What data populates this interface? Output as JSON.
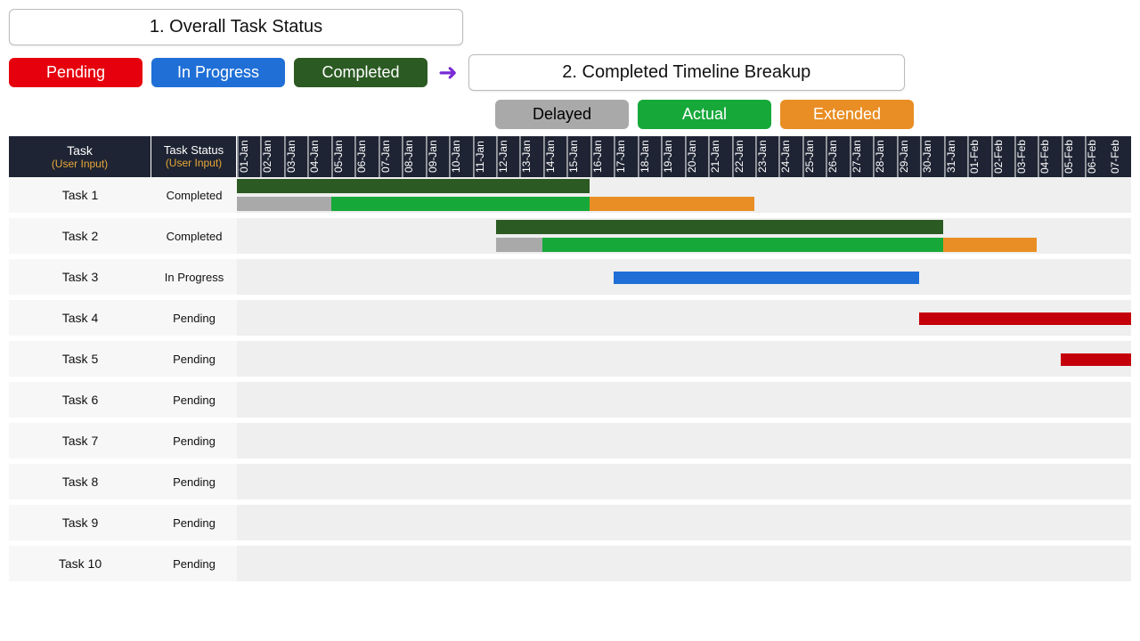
{
  "titles": {
    "overall": "1. Overall Task Status",
    "breakup": "2. Completed Timeline Breakup"
  },
  "legend": {
    "pending": "Pending",
    "in_progress": "In Progress",
    "completed": "Completed",
    "delayed": "Delayed",
    "actual": "Actual",
    "extended": "Extended"
  },
  "columns": {
    "task": "Task",
    "task_sub": "(User Input)",
    "status": "Task Status",
    "status_sub": "(User Input)"
  },
  "dates": [
    "01-Jan",
    "02-Jan",
    "03-Jan",
    "04-Jan",
    "05-Jan",
    "06-Jan",
    "07-Jan",
    "08-Jan",
    "09-Jan",
    "10-Jan",
    "11-Jan",
    "12-Jan",
    "13-Jan",
    "14-Jan",
    "15-Jan",
    "16-Jan",
    "17-Jan",
    "18-Jan",
    "19-Jan",
    "20-Jan",
    "21-Jan",
    "22-Jan",
    "23-Jan",
    "24-Jan",
    "25-Jan",
    "26-Jan",
    "27-Jan",
    "28-Jan",
    "29-Jan",
    "30-Jan",
    "31-Jan",
    "01-Feb",
    "02-Feb",
    "03-Feb",
    "04-Feb",
    "05-Feb",
    "06-Feb",
    "07-Feb"
  ],
  "tasks": [
    {
      "name": "Task 1",
      "status": "Completed"
    },
    {
      "name": "Task 2",
      "status": "Completed"
    },
    {
      "name": "Task 3",
      "status": "In Progress"
    },
    {
      "name": "Task 4",
      "status": "Pending"
    },
    {
      "name": "Task 5",
      "status": "Pending"
    },
    {
      "name": "Task 6",
      "status": "Pending"
    },
    {
      "name": "Task 7",
      "status": "Pending"
    },
    {
      "name": "Task 8",
      "status": "Pending"
    },
    {
      "name": "Task 9",
      "status": "Pending"
    },
    {
      "name": "Task 10",
      "status": "Pending"
    }
  ],
  "chart_data": {
    "type": "gantt",
    "title": "Overall Task Status / Completed Timeline Breakup",
    "date_range": {
      "start": "01-Jan",
      "end": "07-Feb",
      "num_days": 38
    },
    "status_colors": {
      "Pending": "#e6000d",
      "In Progress": "#1f6fd6",
      "Completed": "#2b5a22",
      "Delayed": "#a9a9a9",
      "Actual": "#17a83a",
      "Extended": "#e98e24"
    },
    "rows": [
      {
        "task": "Task 1",
        "status": "Completed",
        "bars": [
          {
            "kind": "plan",
            "start": 1,
            "end": 15
          },
          {
            "kind": "delayed",
            "start": 1,
            "end": 4
          },
          {
            "kind": "actual",
            "start": 5,
            "end": 15
          },
          {
            "kind": "extended",
            "start": 16,
            "end": 22
          }
        ]
      },
      {
        "task": "Task 2",
        "status": "Completed",
        "bars": [
          {
            "kind": "plan",
            "start": 12,
            "end": 30
          },
          {
            "kind": "delayed",
            "start": 12,
            "end": 13
          },
          {
            "kind": "actual",
            "start": 14,
            "end": 30
          },
          {
            "kind": "extended",
            "start": 31,
            "end": 34
          }
        ]
      },
      {
        "task": "Task 3",
        "status": "In Progress",
        "bars": [
          {
            "kind": "inprogress",
            "start": 17,
            "end": 29
          }
        ]
      },
      {
        "task": "Task 4",
        "status": "Pending",
        "bars": [
          {
            "kind": "pending",
            "start": 30,
            "end": 38
          }
        ]
      },
      {
        "task": "Task 5",
        "status": "Pending",
        "bars": [
          {
            "kind": "pending",
            "start": 36,
            "end": 38
          }
        ]
      },
      {
        "task": "Task 6",
        "status": "Pending",
        "bars": []
      },
      {
        "task": "Task 7",
        "status": "Pending",
        "bars": []
      },
      {
        "task": "Task 8",
        "status": "Pending",
        "bars": []
      },
      {
        "task": "Task 9",
        "status": "Pending",
        "bars": []
      },
      {
        "task": "Task 10",
        "status": "Pending",
        "bars": []
      }
    ]
  }
}
